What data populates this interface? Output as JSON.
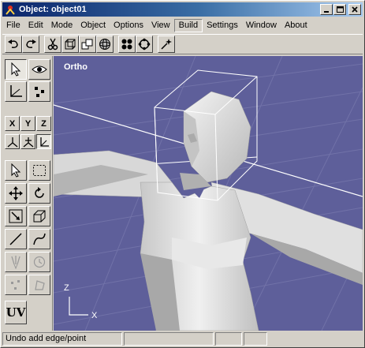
{
  "window": {
    "title": "Object: object01"
  },
  "title_controls": {
    "minimize": "_",
    "maximize": "□",
    "close": "×"
  },
  "menu": {
    "items": [
      "File",
      "Edit",
      "Mode",
      "Object",
      "Options",
      "View",
      "Build",
      "Settings",
      "Window",
      "About"
    ],
    "active": "Build"
  },
  "toolbar": {
    "buttons": [
      "undo-icon",
      "redo-icon",
      "cut-icon",
      "cube-wire-icon",
      "cube-duplicate-icon",
      "sphere-icon",
      "four-dots-icon",
      "rotate-cycle-icon",
      "sparkle-icon"
    ]
  },
  "palette": {
    "axes": {
      "x": "X",
      "y": "Y",
      "z": "Z"
    },
    "uv_label": "UV"
  },
  "viewport": {
    "label": "Ortho",
    "axis_labels": {
      "z": "Z",
      "x": "X"
    },
    "background": "#5e5f9a"
  },
  "status": {
    "message": "Undo add edge/point",
    "cell2": "",
    "cell3": "",
    "cell4": ""
  }
}
